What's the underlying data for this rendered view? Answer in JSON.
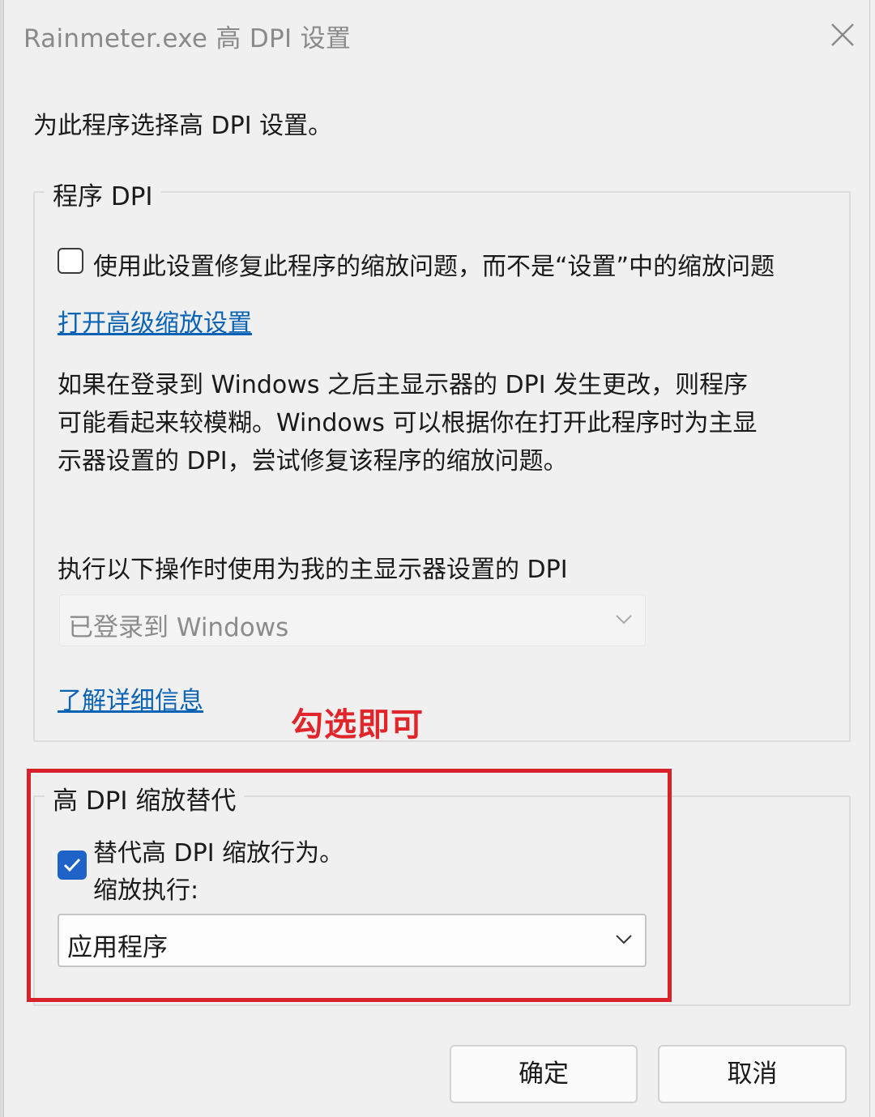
{
  "window": {
    "title": "Rainmeter.exe 高 DPI 设置"
  },
  "prompt": "为此程序选择高 DPI 设置。",
  "program_dpi": {
    "legend": "程序 DPI",
    "checkbox_label": "使用此设置修复此程序的缩放问题，而不是“设置”中的缩放问题",
    "checkbox_checked": false,
    "advanced_link": "打开高级缩放设置",
    "description_lines": [
      "如果在登录到 Windows 之后主显示器的 DPI 发生更改，则程序",
      "可能看起来较模糊。Windows 可以根据你在打开此程序时为主显",
      "示器设置的 DPI，尝试修复该程序的缩放问题。"
    ],
    "dropdown_label": "执行以下操作时使用为我的主显示器设置的 DPI",
    "dropdown_value": "已登录到 Windows",
    "dropdown_enabled": false,
    "learn_more_link": "了解详细信息"
  },
  "annotation": {
    "text": "勾选即可",
    "color": "#e0262a"
  },
  "override": {
    "legend": "高 DPI 缩放替代",
    "checkbox_label_line1": "替代高 DPI 缩放行为。",
    "checkbox_label_line2": "缩放执行:",
    "checkbox_checked": true,
    "dropdown_value": "应用程序",
    "highlight_color": "#d8212a"
  },
  "buttons": {
    "ok": "确定",
    "cancel": "取消"
  },
  "colors": {
    "accent": "#1f62c8",
    "link": "#0a63b4"
  },
  "icons": {
    "close": "close-icon",
    "chevron": "chevron-down-icon",
    "check": "checkmark-icon"
  }
}
